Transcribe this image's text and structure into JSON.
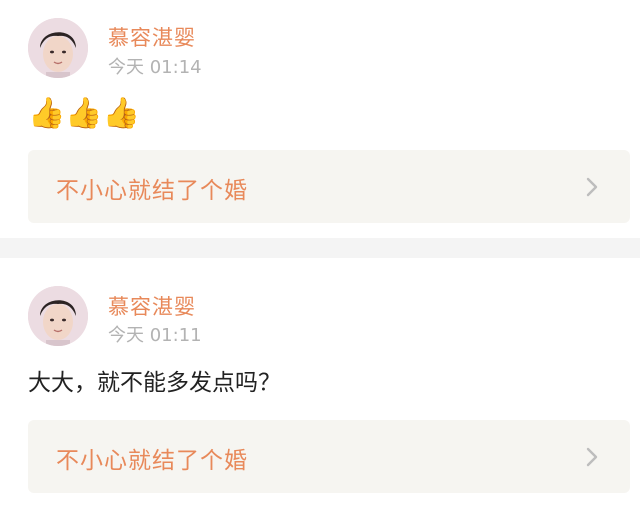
{
  "posts": [
    {
      "username": "慕容湛婴",
      "timestamp": "今天 01:14",
      "content": "👍👍👍",
      "link_title": "不小心就结了个婚"
    },
    {
      "username": "慕容湛婴",
      "timestamp": "今天 01:11",
      "content": "大大，就不能多发点吗？",
      "link_title": "不小心就结了个婚"
    }
  ],
  "colors": {
    "accent": "#e8895a",
    "timestamp": "#b3b3b3",
    "link_bg": "#f6f5f1",
    "separator": "#f4f4f4"
  },
  "icons": {
    "avatar": "user-avatar",
    "chevron": "chevron-right-icon"
  }
}
